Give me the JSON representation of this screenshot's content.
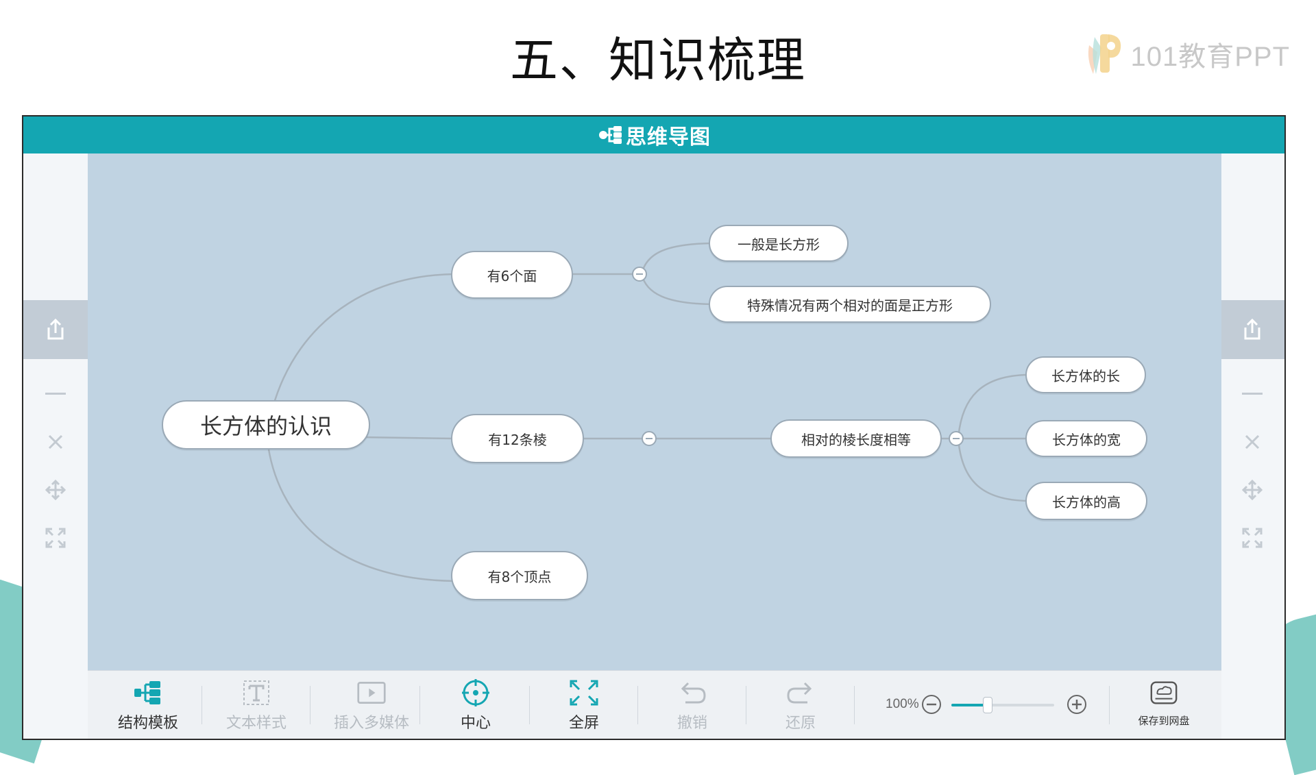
{
  "slide": {
    "title": "五、知识梳理",
    "brand": "101教育PPT"
  },
  "app": {
    "title": "思维导图",
    "colors": {
      "accent": "#14a6b2",
      "canvas": "#c0d3e2",
      "node_border": "#9aa9b6",
      "line": "#a7b3bd"
    }
  },
  "sidebar": {
    "tools": [
      "export-icon",
      "minus-icon",
      "close-icon",
      "move-icon",
      "fit-icon"
    ]
  },
  "mindmap": {
    "root": "长方体的认识",
    "branches": [
      {
        "label": "有6个面",
        "children": [
          "一般是长方形",
          "特殊情况有两个相对的面是正方形"
        ]
      },
      {
        "label": "有12条棱",
        "children": [
          {
            "label": "相对的棱长度相等",
            "children": [
              "长方体的长",
              "长方体的宽",
              "长方体的高"
            ]
          }
        ]
      },
      {
        "label": "有8个顶点",
        "children": []
      }
    ]
  },
  "toolbar": {
    "structure": "结构模板",
    "text_style": "文本样式",
    "insert_media": "插入多媒体",
    "center": "中心",
    "fullscreen": "全屏",
    "undo": "撤销",
    "redo": "还原",
    "zoom": "100%",
    "zoom_level": 0.35,
    "save": "保存到网盘"
  }
}
